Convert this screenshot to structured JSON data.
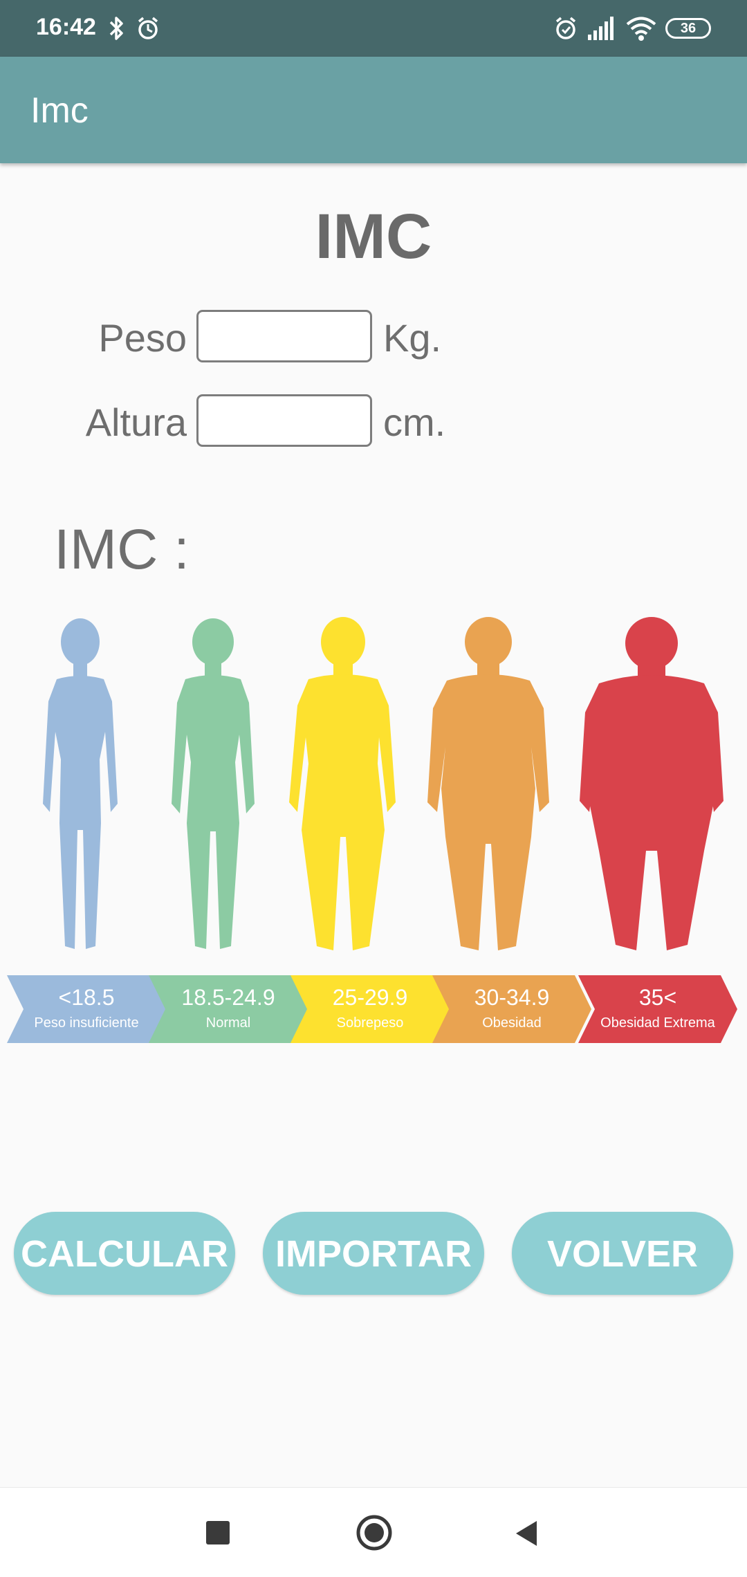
{
  "status_bar": {
    "time": "16:42",
    "battery": "36",
    "icons": [
      "bluetooth-icon",
      "alarm-icon",
      "alarm-icon",
      "signal-icon",
      "wifi-icon",
      "battery-icon"
    ]
  },
  "app_bar": {
    "title": "Imc"
  },
  "main": {
    "title": "IMC",
    "weight": {
      "label": "Peso",
      "value": "",
      "unit": "Kg."
    },
    "height": {
      "label": "Altura",
      "value": "",
      "unit": "cm."
    },
    "result_label": "IMC :"
  },
  "bmi_chart": {
    "categories": [
      {
        "range": "<18.5",
        "name": "Peso insuficiente",
        "color": "#9bbadc"
      },
      {
        "range": "18.5-24.9",
        "name": "Normal",
        "color": "#8ccba3"
      },
      {
        "range": "25-29.9",
        "name": "Sobrepeso",
        "color": "#fde12f"
      },
      {
        "range": "30-34.9",
        "name": "Obesidad",
        "color": "#e9a351"
      },
      {
        "range": "35<",
        "name": "Obesidad Extrema",
        "color": "#d9434b"
      }
    ]
  },
  "buttons": {
    "calcular": "CALCULAR",
    "importar": "IMPORTAR",
    "volver": "VOLVER"
  },
  "nav_bar": {
    "icons": [
      "recents-icon",
      "home-icon",
      "back-icon"
    ]
  }
}
